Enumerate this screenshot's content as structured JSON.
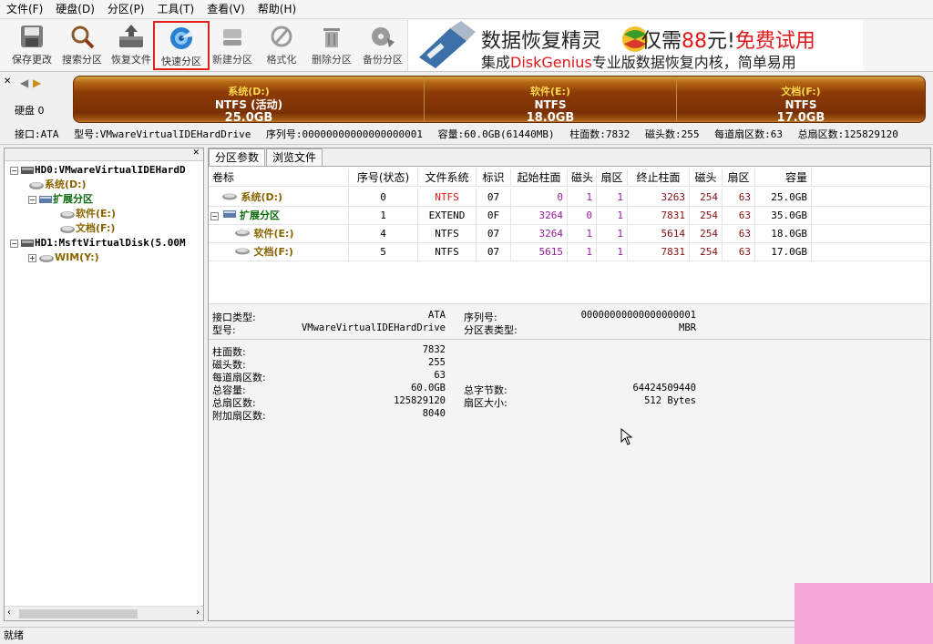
{
  "menu": [
    "文件(F)",
    "硬盘(D)",
    "分区(P)",
    "工具(T)",
    "查看(V)",
    "帮助(H)"
  ],
  "toolbar": {
    "save": "保存更改",
    "search": "搜索分区",
    "recover": "恢复文件",
    "quick": "快速分区",
    "new": "新建分区",
    "format": "格式化",
    "delete": "删除分区",
    "backup": "备份分区"
  },
  "banner": {
    "line1_a": "数据恢复精灵",
    "line1_b": "仅需",
    "line1_price": "88",
    "line1_c": "元!",
    "line1_free": "免费试用",
    "line2_a": "集成",
    "line2_brand": "DiskGenius",
    "line2_b": "专业版数据恢复内核，简单易用"
  },
  "diskmap": {
    "label": "硬盘 0",
    "segments": [
      {
        "name": "系统(D:)",
        "fs": "NTFS (活动)",
        "size": "25.0GB"
      },
      {
        "name": "软件(E:)",
        "fs": "NTFS",
        "size": "18.0GB"
      },
      {
        "name": "文档(F:)",
        "fs": "NTFS",
        "size": "17.0GB"
      }
    ]
  },
  "diskinfo": {
    "iface": "接口:ATA",
    "model": "型号:VMwareVirtualIDEHardDrive",
    "serial": "序列号:00000000000000000001",
    "capacity": "容量:60.0GB(61440MB)",
    "cylinders": "柱面数:7832",
    "heads": "磁头数:255",
    "sectors_per_track": "每道扇区数:63",
    "total_sectors": "总扇区数:125829120"
  },
  "tree": {
    "hd0": "HD0:VMwareVirtualIDEHardD",
    "sys": "系统(D:)",
    "ext": "扩展分区",
    "soft": "软件(E:)",
    "doc": "文档(F:)",
    "hd1": "HD1:MsftVirtualDisk(5.00M",
    "wim": "WIM(Y:)"
  },
  "tabs": [
    "分区参数",
    "浏览文件"
  ],
  "table": {
    "headers": [
      "卷标",
      "序号(状态)",
      "文件系统",
      "标识",
      "起始柱面",
      "磁头",
      "扇区",
      "终止柱面",
      "磁头",
      "扇区",
      "容量"
    ],
    "rows": [
      [
        "系统(D:)",
        "0",
        "NTFS",
        "07",
        "0",
        "1",
        "1",
        "3263",
        "254",
        "63",
        "25.0GB"
      ],
      [
        "扩展分区",
        "1",
        "EXTEND",
        "0F",
        "3264",
        "0",
        "1",
        "7831",
        "254",
        "63",
        "35.0GB"
      ],
      [
        "软件(E:)",
        "4",
        "NTFS",
        "07",
        "3264",
        "1",
        "1",
        "5614",
        "254",
        "63",
        "18.0GB"
      ],
      [
        "文档(F:)",
        "5",
        "NTFS",
        "07",
        "5615",
        "1",
        "1",
        "7831",
        "254",
        "63",
        "17.0GB"
      ]
    ]
  },
  "info": {
    "iface_type_lbl": "接口类型:",
    "iface_type": "ATA",
    "model_lbl": "型号:",
    "model": "VMwareVirtualIDEHardDrive",
    "serial_lbl": "序列号:",
    "serial": "00000000000000000001",
    "ptable_lbl": "分区表类型:",
    "ptable": "MBR",
    "cyl_lbl": "柱面数:",
    "cyl": "7832",
    "heads_lbl": "磁头数:",
    "heads": "255",
    "spt_lbl": "每道扇区数:",
    "spt": "63",
    "cap_lbl": "总容量:",
    "cap": "60.0GB",
    "bytes_lbl": "总字节数:",
    "bytes": "64424509440",
    "tsec_lbl": "总扇区数:",
    "tsec": "125829120",
    "secsize_lbl": "扇区大小:",
    "secsize": "512 Bytes",
    "extra_lbl": "附加扇区数:",
    "extra": "8040"
  },
  "status": "就绪"
}
